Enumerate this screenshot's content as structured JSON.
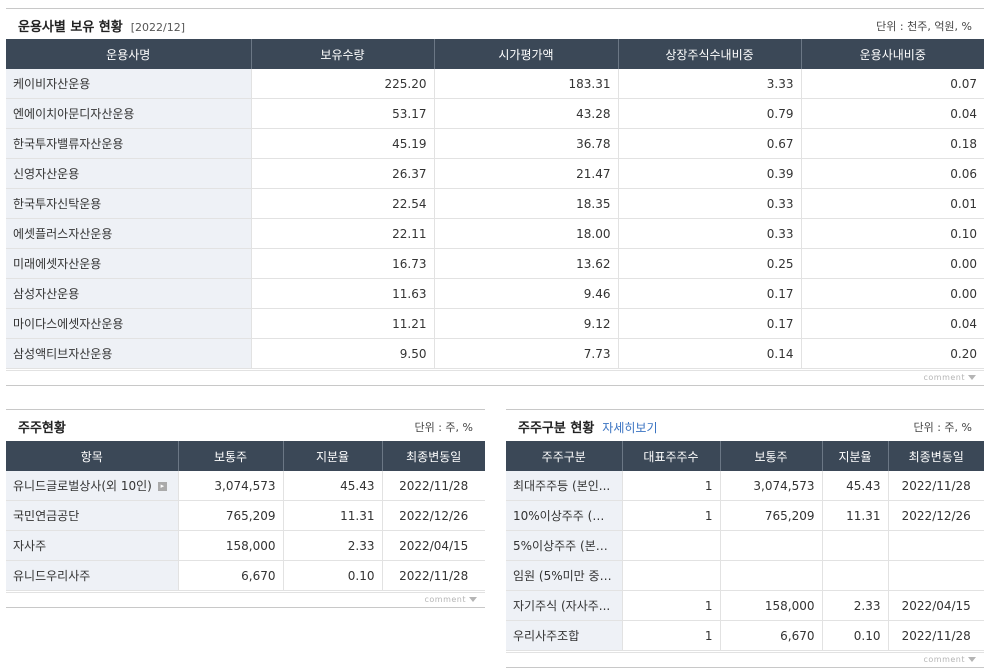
{
  "section1": {
    "title": "운용사별 보유 현황",
    "period": "[2022/12]",
    "unit": "단위 : 천주, 억원, %",
    "headers": [
      "운용사명",
      "보유수량",
      "시가평가액",
      "상장주식수내비중",
      "운용사내비중"
    ],
    "rows": [
      [
        "케이비자산운용",
        "225.20",
        "183.31",
        "3.33",
        "0.07"
      ],
      [
        "엔에이치아문디자산운용",
        "53.17",
        "43.28",
        "0.79",
        "0.04"
      ],
      [
        "한국투자밸류자산운용",
        "45.19",
        "36.78",
        "0.67",
        "0.18"
      ],
      [
        "신영자산운용",
        "26.37",
        "21.47",
        "0.39",
        "0.06"
      ],
      [
        "한국투자신탁운용",
        "22.54",
        "18.35",
        "0.33",
        "0.01"
      ],
      [
        "에셋플러스자산운용",
        "22.11",
        "18.00",
        "0.33",
        "0.10"
      ],
      [
        "미래에셋자산운용",
        "16.73",
        "13.62",
        "0.25",
        "0.00"
      ],
      [
        "삼성자산운용",
        "11.63",
        "9.46",
        "0.17",
        "0.00"
      ],
      [
        "마이다스에셋자산운용",
        "11.21",
        "9.12",
        "0.17",
        "0.04"
      ],
      [
        "삼성액티브자산운용",
        "9.50",
        "7.73",
        "0.14",
        "0.20"
      ]
    ],
    "comment": "comment"
  },
  "section2": {
    "title": "주주현황",
    "unit": "단위 : 주, %",
    "headers": [
      "항목",
      "보통주",
      "지분율",
      "최종변동일"
    ],
    "rows": [
      [
        "유니드글로벌상사(외 10인)",
        "3,074,573",
        "45.43",
        "2022/11/28"
      ],
      [
        "국민연금공단",
        "765,209",
        "11.31",
        "2022/12/26"
      ],
      [
        "자사주",
        "158,000",
        "2.33",
        "2022/04/15"
      ],
      [
        "유니드우리사주",
        "6,670",
        "0.10",
        "2022/11/28"
      ]
    ],
    "comment": "comment"
  },
  "section3": {
    "title": "주주구분 현황",
    "link": "자세히보기",
    "unit": "단위 : 주, %",
    "headers": [
      "주주구분",
      "대표주주수",
      "보통주",
      "지분율",
      "최종변동일"
    ],
    "rows": [
      [
        "최대주주등 (본인...",
        "1",
        "3,074,573",
        "45.43",
        "2022/11/28"
      ],
      [
        "10%이상주주 (본...",
        "1",
        "765,209",
        "11.31",
        "2022/12/26"
      ],
      [
        "5%이상주주 (본인...",
        "",
        "",
        "",
        ""
      ],
      [
        "임원 (5%미만 중, ...",
        "",
        "",
        "",
        ""
      ],
      [
        "자기주식 (자사주...",
        "1",
        "158,000",
        "2.33",
        "2022/04/15"
      ],
      [
        "우리사주조합",
        "1",
        "6,670",
        "0.10",
        "2022/11/28"
      ]
    ],
    "comment": "comment"
  },
  "colors": {
    "header_bg": "#3b4857",
    "label_bg": "#eef1f6",
    "link": "#3a73c2"
  }
}
